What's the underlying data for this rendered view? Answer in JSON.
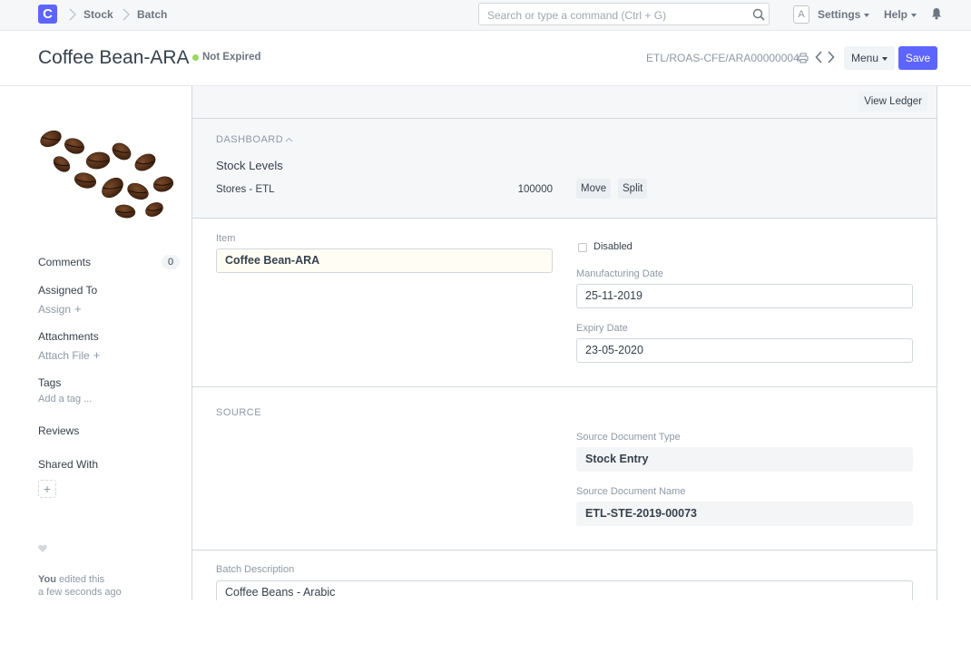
{
  "navbar": {
    "logo_letter": "C",
    "breadcrumbs": [
      "Stock",
      "Batch"
    ],
    "search_placeholder": "Search or type a command (Ctrl + G)",
    "avatar_letter": "A",
    "settings_label": "Settings",
    "help_label": "Help"
  },
  "page": {
    "title": "Coffee Bean-ARA",
    "status": "Not Expired",
    "status_color": "#98d85b",
    "doc_name": "ETL/ROAS-CFE/ARA00000004",
    "menu_label": "Menu",
    "save_label": "Save",
    "accent_color": "#5e64ff"
  },
  "sidebar": {
    "comments_label": "Comments",
    "comments_count": "0",
    "assigned_label": "Assigned To",
    "assign_link": "Assign",
    "attachments_label": "Attachments",
    "attach_link": "Attach File",
    "tags_label": "Tags",
    "tag_placeholder": "Add a tag ...",
    "reviews_label": "Reviews",
    "shared_label": "Shared With",
    "activity_user": "You",
    "activity_action": "edited this",
    "activity_time": "a few seconds ago"
  },
  "toolbar": {
    "view_ledger": "View Ledger"
  },
  "dashboard": {
    "heading": "DASHBOARD",
    "stock_levels_title": "Stock Levels",
    "warehouse": "Stores - ETL",
    "qty": "100000",
    "move_label": "Move",
    "split_label": "Split"
  },
  "details": {
    "item_label": "Item",
    "item_value": "Coffee Bean-ARA",
    "disabled_label": "Disabled",
    "mfg_label": "Manufacturing Date",
    "mfg_value": "25-11-2019",
    "expiry_label": "Expiry Date",
    "expiry_value": "23-05-2020"
  },
  "source": {
    "heading": "SOURCE",
    "doc_type_label": "Source Document Type",
    "doc_type_value": "Stock Entry",
    "doc_name_label": "Source Document Name",
    "doc_name_value": "ETL-STE-2019-00073"
  },
  "description": {
    "label": "Batch Description",
    "value": "Coffee Beans - Arabic"
  }
}
